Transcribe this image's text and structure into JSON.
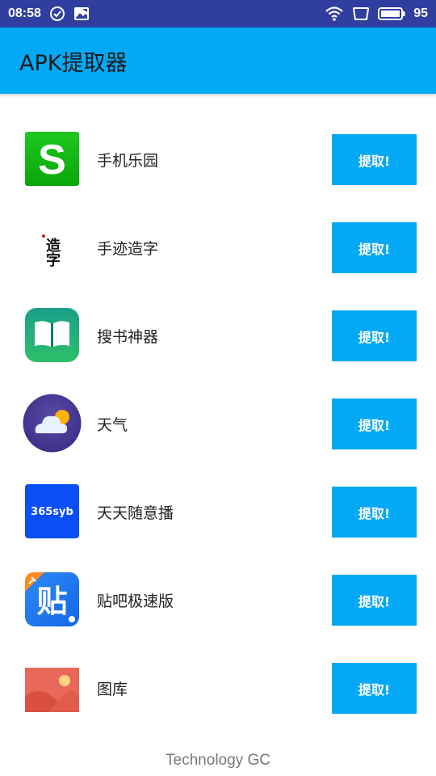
{
  "status_bar": {
    "time": "08:58",
    "battery_level": "95",
    "icons": [
      "check-circle-icon",
      "image-notification-icon",
      "wifi-icon",
      "screen-icon",
      "battery-icon"
    ]
  },
  "app_bar": {
    "title": "APK提取器",
    "color": "#03a9f4"
  },
  "apps": [
    {
      "name": "手机乐园",
      "icon": "shoujileyuan-s-icon",
      "button": "提取!"
    },
    {
      "name": "手迹造字",
      "icon": "shoujizaozi-calligraphy-icon",
      "button": "提取!",
      "icon_text": "造字"
    },
    {
      "name": "搜书神器",
      "icon": "sousushenqi-book-icon",
      "button": "提取!"
    },
    {
      "name": "天气",
      "icon": "weather-cloud-sun-icon",
      "button": "提取!"
    },
    {
      "name": "天天随意播",
      "icon": "tiantiansuiyibo-365syb-icon",
      "button": "提取!",
      "icon_text": "365syb"
    },
    {
      "name": "贴吧极速版",
      "icon": "tieba-lite-icon",
      "button": "提取!",
      "icon_text": "贴"
    },
    {
      "name": "图库",
      "icon": "gallery-picture-icon",
      "button": "提取!"
    }
  ],
  "footer": {
    "text": "Technology GC"
  }
}
